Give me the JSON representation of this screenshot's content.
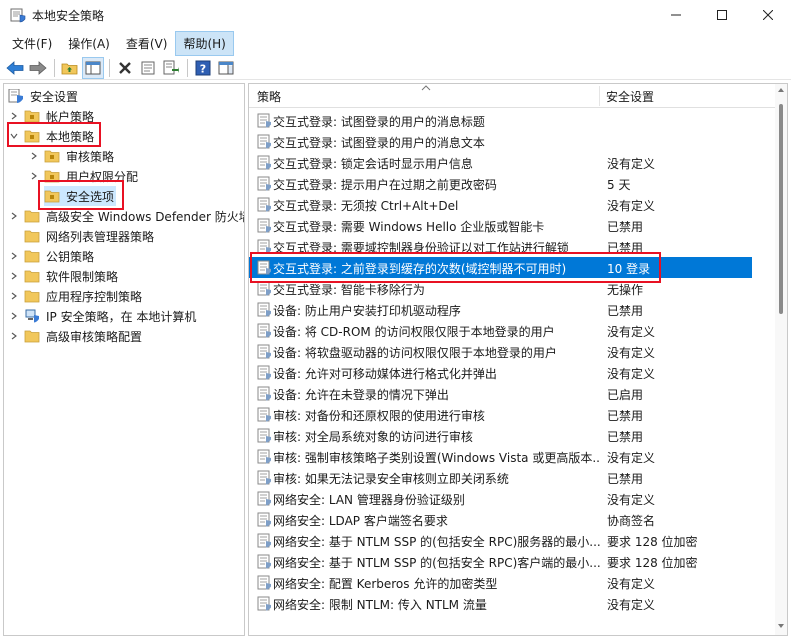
{
  "window": {
    "title": "本地安全策略",
    "controls": [
      "minimize-icon",
      "maximize-icon",
      "close-icon"
    ]
  },
  "menu": [
    {
      "label": "文件(F)"
    },
    {
      "label": "操作(A)"
    },
    {
      "label": "查看(V)"
    },
    {
      "label": "帮助(H)",
      "active": true
    }
  ],
  "toolbar": {
    "icons": [
      "back-arrow-icon",
      "forward-arrow-icon",
      "up-folder-icon",
      "show-tree-icon",
      "delete-icon",
      "properties-icon",
      "export-list-icon",
      "help-icon",
      "show-hide-pane-icon"
    ]
  },
  "tree": [
    {
      "label": "安全设置",
      "depth": 0,
      "expanded": null,
      "icon": "security-settings-icon"
    },
    {
      "label": "帐户策略",
      "depth": 1,
      "expanded": false,
      "icon": "folder-icon"
    },
    {
      "label": "本地策略",
      "depth": 1,
      "expanded": true,
      "icon": "folder-icon",
      "highlighted": true
    },
    {
      "label": "审核策略",
      "depth": 2,
      "expanded": false,
      "icon": "folder-icon"
    },
    {
      "label": "用户权限分配",
      "depth": 2,
      "expanded": false,
      "icon": "folder-icon"
    },
    {
      "label": "安全选项",
      "depth": 2,
      "expanded": null,
      "icon": "folder-icon",
      "selected": true,
      "highlighted": true
    },
    {
      "label": "高级安全 Windows Defender 防火墙",
      "depth": 1,
      "expanded": false,
      "icon": "folder-icon"
    },
    {
      "label": "网络列表管理器策略",
      "depth": 1,
      "expanded": null,
      "icon": "folder-icon"
    },
    {
      "label": "公钥策略",
      "depth": 1,
      "expanded": false,
      "icon": "folder-icon"
    },
    {
      "label": "软件限制策略",
      "depth": 1,
      "expanded": false,
      "icon": "folder-icon"
    },
    {
      "label": "应用程序控制策略",
      "depth": 1,
      "expanded": false,
      "icon": "folder-icon"
    },
    {
      "label": "IP 安全策略，在 本地计算机",
      "depth": 1,
      "expanded": false,
      "icon": "ip-security-icon"
    },
    {
      "label": "高级审核策略配置",
      "depth": 1,
      "expanded": false,
      "icon": "folder-icon"
    }
  ],
  "list": {
    "columns": {
      "policy": "策略",
      "setting": "安全设置"
    },
    "rows": [
      {
        "policy": "交互式登录: 试图登录的用户的消息标题",
        "setting": ""
      },
      {
        "policy": "交互式登录: 试图登录的用户的消息文本",
        "setting": ""
      },
      {
        "policy": "交互式登录: 锁定会话时显示用户信息",
        "setting": "没有定义"
      },
      {
        "policy": "交互式登录: 提示用户在过期之前更改密码",
        "setting": "5 天"
      },
      {
        "policy": "交互式登录: 无须按 Ctrl+Alt+Del",
        "setting": "没有定义"
      },
      {
        "policy": "交互式登录: 需要 Windows Hello 企业版或智能卡",
        "setting": "已禁用"
      },
      {
        "policy": "交互式登录: 需要域控制器身份验证以对工作站进行解锁",
        "setting": "已禁用"
      },
      {
        "policy": "交互式登录: 之前登录到缓存的次数(域控制器不可用时)",
        "setting": "10 登录",
        "selected": true
      },
      {
        "policy": "交互式登录: 智能卡移除行为",
        "setting": "无操作"
      },
      {
        "policy": "设备: 防止用户安装打印机驱动程序",
        "setting": "已禁用"
      },
      {
        "policy": "设备: 将 CD-ROM 的访问权限仅限于本地登录的用户",
        "setting": "没有定义"
      },
      {
        "policy": "设备: 将软盘驱动器的访问权限仅限于本地登录的用户",
        "setting": "没有定义"
      },
      {
        "policy": "设备: 允许对可移动媒体进行格式化并弹出",
        "setting": "没有定义"
      },
      {
        "policy": "设备: 允许在未登录的情况下弹出",
        "setting": "已启用"
      },
      {
        "policy": "审核: 对备份和还原权限的使用进行审核",
        "setting": "已禁用"
      },
      {
        "policy": "审核: 对全局系统对象的访问进行审核",
        "setting": "已禁用"
      },
      {
        "policy": "审核: 强制审核策略子类别设置(Windows Vista 或更高版本...",
        "setting": "没有定义"
      },
      {
        "policy": "审核: 如果无法记录安全审核则立即关闭系统",
        "setting": "已禁用"
      },
      {
        "policy": "网络安全: LAN 管理器身份验证级别",
        "setting": "没有定义"
      },
      {
        "policy": "网络安全: LDAP 客户端签名要求",
        "setting": "协商签名"
      },
      {
        "policy": "网络安全: 基于 NTLM SSP 的(包括安全 RPC)服务器的最小...",
        "setting": "要求 128 位加密"
      },
      {
        "policy": "网络安全: 基于 NTLM SSP 的(包括安全 RPC)客户端的最小...",
        "setting": "要求 128 位加密"
      },
      {
        "policy": "网络安全: 配置 Kerberos 允许的加密类型",
        "setting": "没有定义"
      },
      {
        "policy": "网络安全: 限制 NTLM: 传入 NTLM 流量",
        "setting": "没有定义"
      }
    ]
  },
  "colors": {
    "selection": "#0078d7",
    "highlight_box": "#e81123",
    "folder": "#f1c75b",
    "menu_active": "#cce4f7"
  }
}
